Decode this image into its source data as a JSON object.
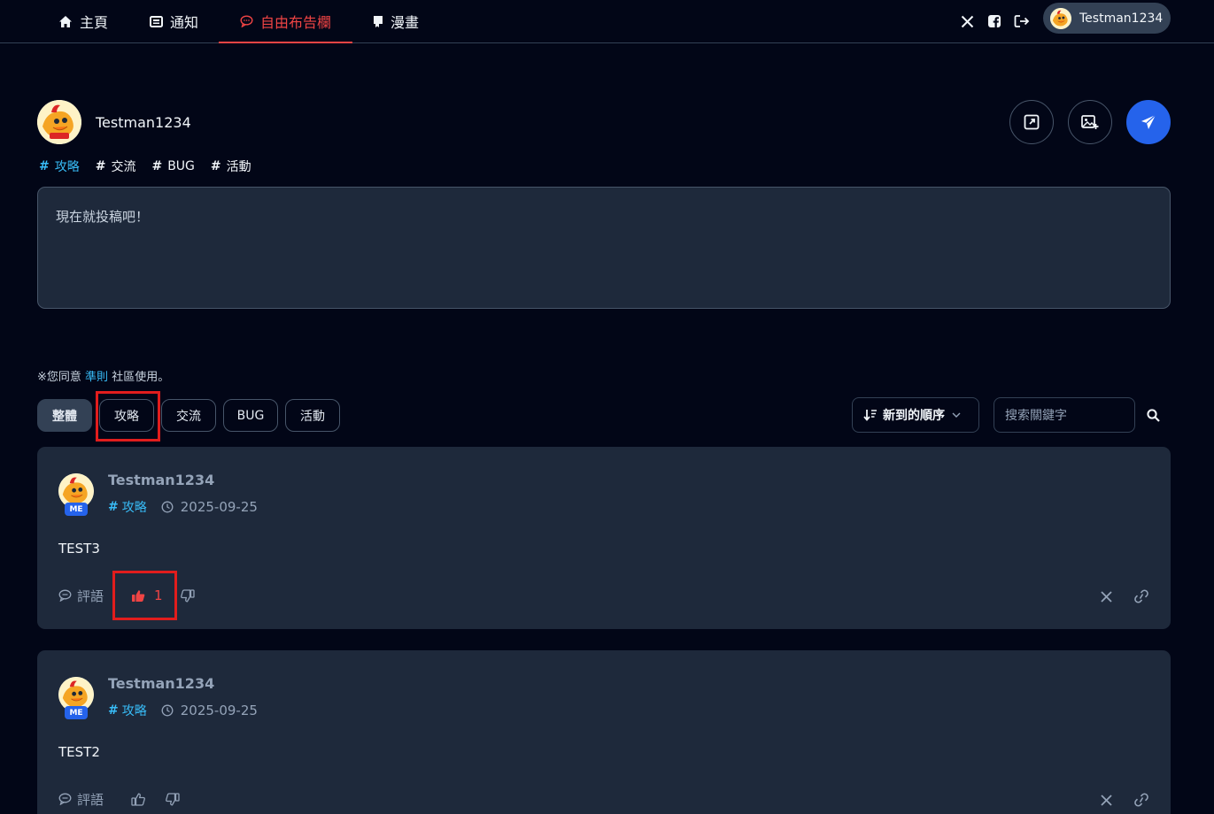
{
  "nav": {
    "tabs": [
      {
        "label": "主頁",
        "icon": "home-icon"
      },
      {
        "label": "通知",
        "icon": "newspaper-icon"
      },
      {
        "label": "自由布告欄",
        "icon": "chat-bubble-icon",
        "active": true
      },
      {
        "label": "漫畫",
        "icon": "book-icon"
      }
    ],
    "user": {
      "name": "Testman1234"
    }
  },
  "composer": {
    "user_name": "Testman1234",
    "tags": [
      {
        "label": "攻略",
        "selected": true
      },
      {
        "label": "交流"
      },
      {
        "label": "BUG"
      },
      {
        "label": "活動"
      }
    ],
    "placeholder": "現在就投稿吧！"
  },
  "agreement": {
    "prefix": "※您同意",
    "link": "準則",
    "suffix": "社區使用。"
  },
  "filters": {
    "chips": [
      "整體",
      "攻略",
      "交流",
      "BUG",
      "活動"
    ],
    "active": "整體",
    "sort_label": "新到的順序",
    "search_placeholder": "搜索關鍵字"
  },
  "posts": [
    {
      "author": "Testman1234",
      "badge": "ME",
      "tag": "攻略",
      "date": "2025-09-25",
      "body": "TEST3",
      "comment_label": "評語",
      "like_count": "1",
      "liked": true
    },
    {
      "author": "Testman1234",
      "badge": "ME",
      "tag": "攻略",
      "date": "2025-09-25",
      "body": "TEST2",
      "comment_label": "評語",
      "like_count": "",
      "liked": false
    }
  ],
  "colors": {
    "background": "#020617",
    "card": "#1e293b",
    "accent_red": "#ef4444",
    "accent_blue": "#2563eb",
    "tag_blue": "#38bdf8",
    "annotation_box": "#e11d1d"
  }
}
